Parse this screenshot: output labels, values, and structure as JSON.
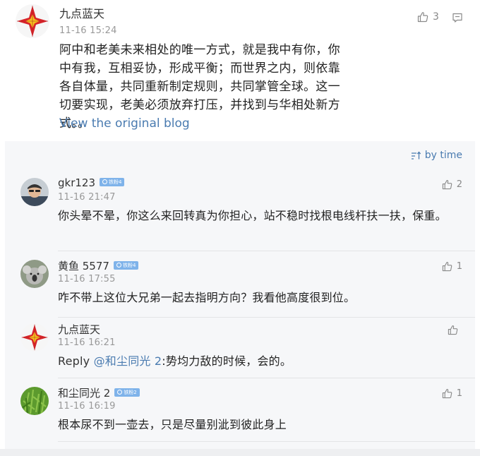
{
  "post": {
    "username": "九点蓝天",
    "time": "11-16 15:24",
    "likes": "3",
    "text": "阿中和老美未来相处的唯一方式，就是我中有你，你中有我，互相妥协，形成平衡；而世界之内，则依靠各自体量，共同重新制定规则，共同掌管全球。这一切要实现，老美必须放弃打压，并找到与华相处新方式。。",
    "link": "View the original blog"
  },
  "sort": {
    "label": "by time"
  },
  "comments": [
    {
      "username": "gkr123",
      "badge": "铁粉4",
      "time": "11-16 21:47",
      "likes": "2",
      "text": "你头晕不晕，你这么来回转真为你担心，站不稳时找根电线杆扶一扶，保重。"
    },
    {
      "username": "黄鱼 5577",
      "badge": "铁粉4",
      "time": "11-16 17:55",
      "likes": "1",
      "text": "咋不带上这位大兄弟一起去指明方向？我看他高度很到位。"
    },
    {
      "username": "九点蓝天",
      "time": "11-16 16:21",
      "likes": "",
      "reply_label": "Reply",
      "mention": "@和尘同光 2",
      "text": ":势均力敌的时候，会的。"
    },
    {
      "username": "和尘同光 2",
      "badge": "铁粉2",
      "time": "11-16 16:19",
      "likes": "1",
      "text": "根本尿不到一壶去，只是尽量别泚到彼此身上"
    }
  ],
  "colors": {
    "link": "#4a7bb0",
    "badge": "#7fb3ea",
    "panel": "#f6f7f9",
    "star_red": "#d8252a",
    "star_gold": "#f4c51e"
  },
  "icons": [
    "thumbs-up-icon",
    "comment-icon",
    "sort-icon"
  ]
}
